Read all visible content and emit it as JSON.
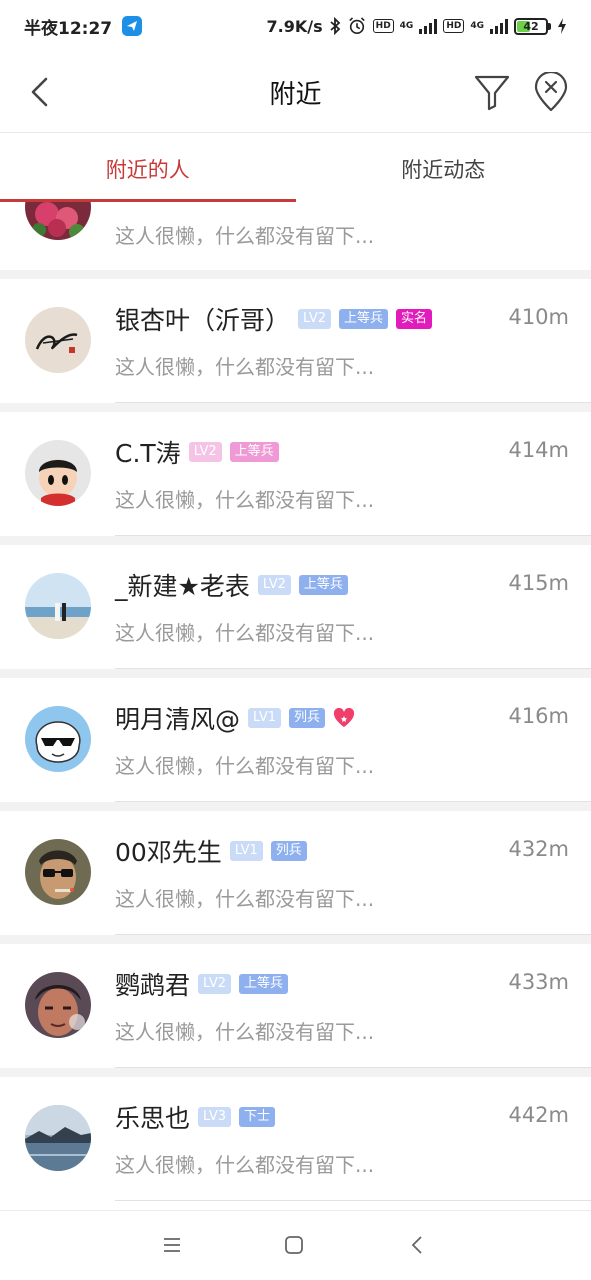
{
  "status_bar": {
    "time": "半夜12:27",
    "speed": "7.9K/s",
    "network_1": "4G",
    "network_2": "4G",
    "hd": "HD",
    "battery": "42",
    "colors": {
      "app_icon": "#1e8fe6",
      "battery_fill": "#6bd04a"
    }
  },
  "header": {
    "title": "附近",
    "icons": {
      "back": "back-arrow-icon",
      "filter": "filter-icon",
      "location_clear": "location-clear-icon"
    }
  },
  "tabs": [
    {
      "label": "附近的人",
      "active": true
    },
    {
      "label": "附近动态",
      "active": false
    }
  ],
  "accent_color": "#c63a3a",
  "partial_row": {
    "bio": "这人很懒，什么都没有留下..."
  },
  "people": [
    {
      "name": "银杏叶（沂哥）",
      "level": "LV2",
      "rank": "上等兵",
      "verified": "实名",
      "distance": "410m",
      "bio": "这人很懒，什么都没有留下...",
      "badge_theme": "blue"
    },
    {
      "name": "C.T涛",
      "level": "LV2",
      "rank": "上等兵",
      "distance": "414m",
      "bio": "这人很懒，什么都没有留下...",
      "badge_theme": "pink"
    },
    {
      "name": "_新建★老表",
      "level": "LV2",
      "rank": "上等兵",
      "distance": "415m",
      "bio": "这人很懒，什么都没有留下...",
      "badge_theme": "blue"
    },
    {
      "name": "明月清风@",
      "level": "LV1",
      "rank": "列兵",
      "heart": true,
      "distance": "416m",
      "bio": "这人很懒，什么都没有留下...",
      "badge_theme": "blue"
    },
    {
      "name": "00邓先生",
      "level": "LV1",
      "rank": "列兵",
      "distance": "432m",
      "bio": "这人很懒，什么都没有留下...",
      "badge_theme": "blue"
    },
    {
      "name": "鹦鹉君",
      "level": "LV2",
      "rank": "上等兵",
      "distance": "433m",
      "bio": "这人很懒，什么都没有留下...",
      "badge_theme": "blue"
    },
    {
      "name": "乐思也",
      "level": "LV3",
      "rank": "下士",
      "distance": "442m",
      "bio": "这人很懒，什么都没有留下...",
      "badge_theme": "blue"
    }
  ],
  "navbar": {
    "icons": [
      "menu-icon",
      "home-square-icon",
      "back-chevron-icon"
    ]
  }
}
